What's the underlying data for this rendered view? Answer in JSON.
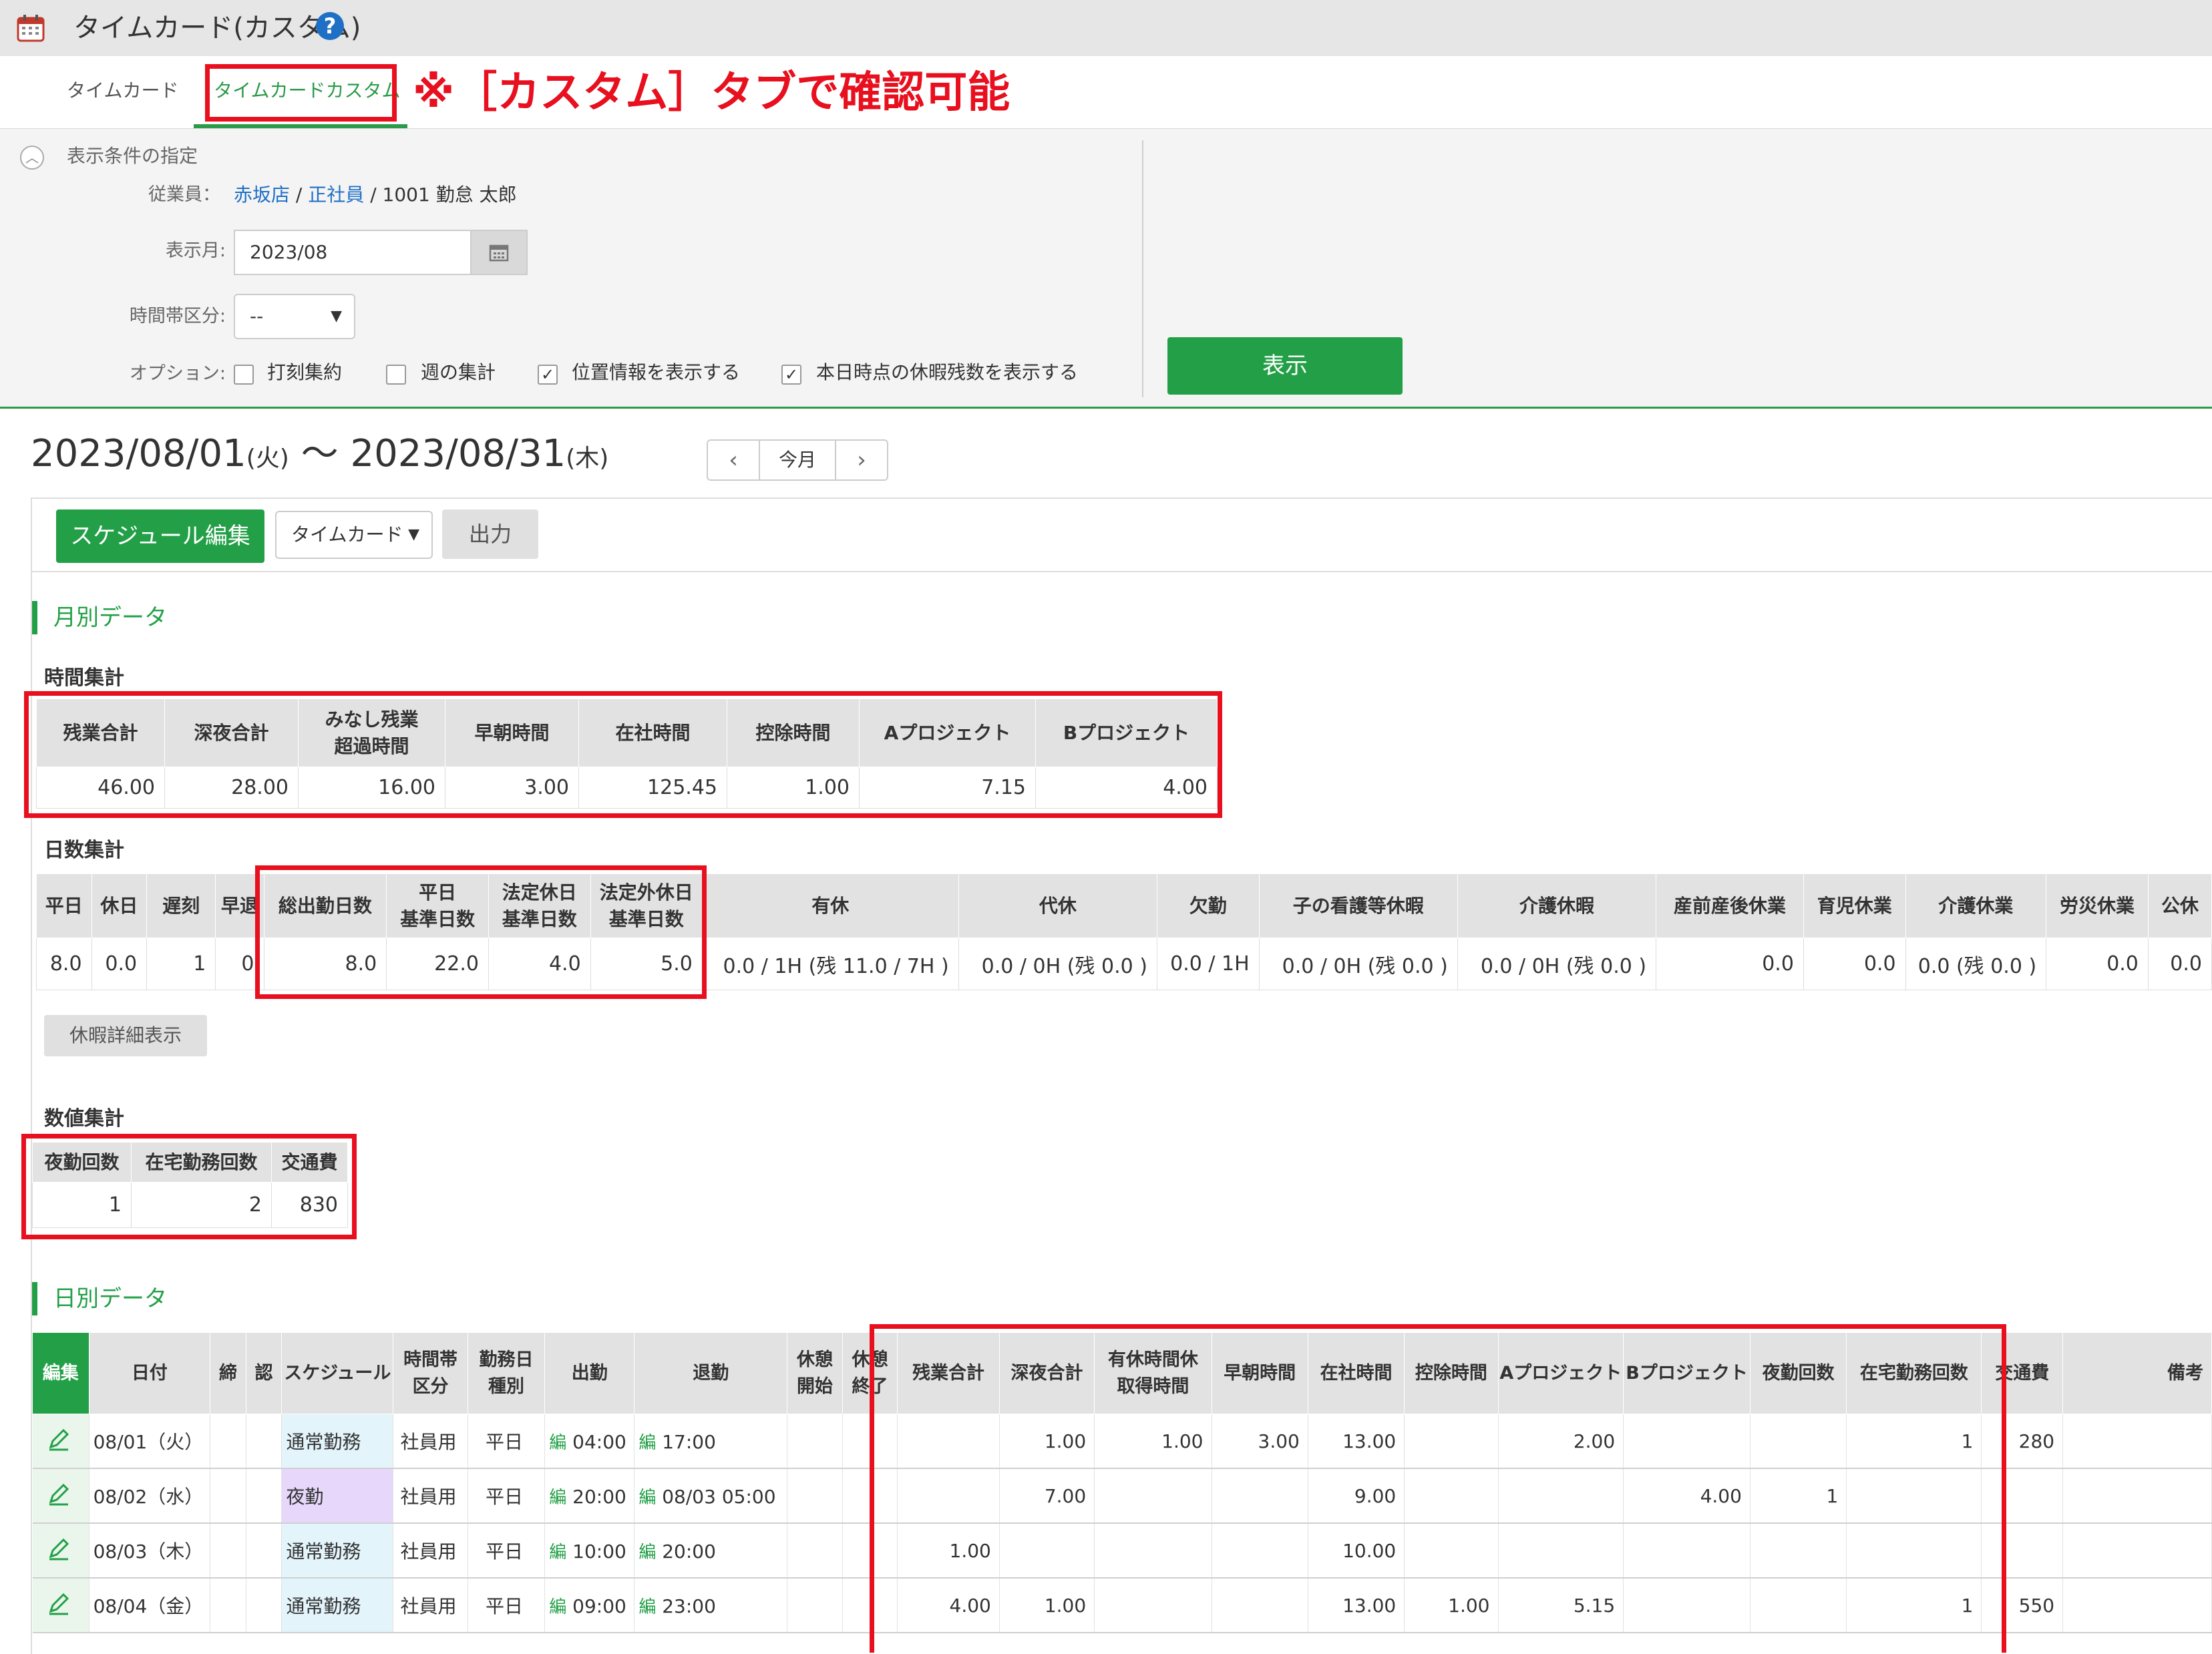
{
  "app": {
    "title": "タイムカード(カスタム)",
    "help": "?"
  },
  "tabs": {
    "timecard": "タイムカード",
    "custom": "タイムカードカスタム",
    "annotation": "※［カスタム］タブで確認可能"
  },
  "conditions": {
    "title": "表示条件の指定",
    "employee_label": "従業員：",
    "employee_store": "赤坂店",
    "employee_sep1": "/",
    "employee_type": "正社員",
    "employee_sep2": "/",
    "employee_name": "1001 勤怠 太郎",
    "month_label": "表示月:",
    "month_value": "2023/08",
    "timezone_label": "時間帯区分:",
    "timezone_value": "--",
    "option_label": "オプション:",
    "options": [
      {
        "label": "打刻集約",
        "checked": false
      },
      {
        "label": "週の集計",
        "checked": false
      },
      {
        "label": "位置情報を表示する",
        "checked": true
      },
      {
        "label": "本日時点の休暇残数を表示する",
        "checked": true
      }
    ],
    "show_button": "表示"
  },
  "period": {
    "start": "2023/08/01",
    "start_dow": "(火)",
    "tilde": "〜",
    "end": "2023/08/31",
    "end_dow": "(木)",
    "prev": "‹",
    "today": "今月",
    "next": "›"
  },
  "toolbar": {
    "schedule_edit": "スケジュール編集",
    "timecard_select": "タイムカード",
    "output": "出力"
  },
  "monthly": {
    "title": "月別データ",
    "time_summary": {
      "title": "時間集計",
      "headers": [
        "残業合計",
        "深夜合計",
        "みなし残業\n超過時間",
        "早朝時間",
        "在社時間",
        "控除時間",
        "Aプロジェクト",
        "Bプロジェクト"
      ],
      "values": [
        "46.00",
        "28.00",
        "16.00",
        "3.00",
        "125.45",
        "1.00",
        "7.15",
        "4.00"
      ]
    },
    "day_summary": {
      "title": "日数集計",
      "headers": [
        "平日",
        "休日",
        "遅刻",
        "早退",
        "総出勤日数",
        "平日\n基準日数",
        "法定休日\n基準日数",
        "法定外休日\n基準日数",
        "有休",
        "代休",
        "欠勤",
        "子の看護等休暇",
        "介護休暇",
        "産前産後休業",
        "育児休業",
        "介護休業",
        "労災休業",
        "公休"
      ],
      "values": [
        "8.0",
        "0.0",
        "1",
        "0",
        "8.0",
        "22.0",
        "4.0",
        "5.0",
        "0.0 / 1H (残 11.0 / 7H )",
        "0.0 / 0H (残 0.0 )",
        "0.0 / 1H",
        "0.0 / 0H (残 0.0 )",
        "0.0 / 0H (残 0.0 )",
        "0.0",
        "0.0",
        "0.0 (残 0.0 )",
        "0.0",
        "0.0"
      ]
    },
    "vacation_detail_button": "休暇詳細表示",
    "numeric_summary": {
      "title": "数値集計",
      "headers": [
        "夜勤回数",
        "在宅勤務回数",
        "交通費"
      ],
      "values": [
        "1",
        "2",
        "830"
      ]
    }
  },
  "daily": {
    "title": "日別データ",
    "headers": [
      "編集",
      "日付",
      "締",
      "認",
      "スケジュール",
      "時間帯\n区分",
      "勤務日\n種別",
      "出勤",
      "退勤",
      "休憩\n開始",
      "休憩\n終了",
      "残業合計",
      "深夜合計",
      "有休時間休\n取得時間",
      "早朝時間",
      "在社時間",
      "控除時間",
      "Aプロジェクト",
      "Bプロジェクト",
      "夜勤回数",
      "在宅勤務回数",
      "交通費",
      "備考"
    ],
    "edit_tag": "編",
    "rows": [
      {
        "date": "08/01（火）",
        "schedule": "通常勤務",
        "schedule_type": "normal",
        "zone": "社員用",
        "daytype": "平日",
        "in": "04:00",
        "out": "17:00",
        "overtime": "",
        "night": "1.00",
        "paid_hours": "1.00",
        "early": "3.00",
        "onsite": "13.00",
        "deduct": "",
        "proj_a": "2.00",
        "proj_b": "",
        "night_count": "",
        "remote": "1",
        "transport": "280"
      },
      {
        "date": "08/02（水）",
        "schedule": "夜勤",
        "schedule_type": "night",
        "zone": "社員用",
        "daytype": "平日",
        "in": "20:00",
        "out": "08/03 05:00",
        "overtime": "",
        "night": "7.00",
        "paid_hours": "",
        "early": "",
        "onsite": "9.00",
        "deduct": "",
        "proj_a": "",
        "proj_b": "4.00",
        "night_count": "1",
        "remote": "",
        "transport": ""
      },
      {
        "date": "08/03（木）",
        "schedule": "通常勤務",
        "schedule_type": "normal",
        "zone": "社員用",
        "daytype": "平日",
        "in": "10:00",
        "out": "20:00",
        "overtime": "1.00",
        "night": "",
        "paid_hours": "",
        "early": "",
        "onsite": "10.00",
        "deduct": "",
        "proj_a": "",
        "proj_b": "",
        "night_count": "",
        "remote": "",
        "transport": ""
      },
      {
        "date": "08/04（金）",
        "schedule": "通常勤務",
        "schedule_type": "normal",
        "zone": "社員用",
        "daytype": "平日",
        "in": "09:00",
        "out": "23:00",
        "overtime": "4.00",
        "night": "1.00",
        "paid_hours": "",
        "early": "",
        "onsite": "13.00",
        "deduct": "1.00",
        "proj_a": "5.15",
        "proj_b": "",
        "night_count": "",
        "remote": "1",
        "transport": "550"
      }
    ]
  },
  "colors": {
    "accent_green": "#23a047",
    "highlight_red": "#e8101e",
    "link_blue": "#1f6fc5"
  }
}
